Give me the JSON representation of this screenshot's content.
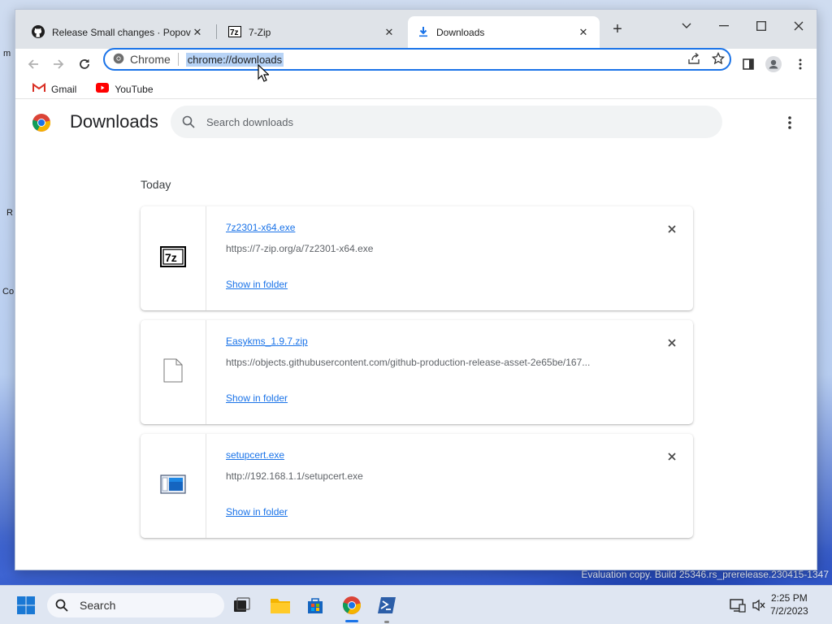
{
  "browser": {
    "tabs": [
      {
        "title": "Release Small changes · PopovEvgeniy",
        "icon": "github-icon",
        "active": false
      },
      {
        "title": "7-Zip",
        "icon": "7zip-icon",
        "active": false
      },
      {
        "title": "Downloads",
        "icon": "download-icon",
        "active": true
      }
    ],
    "omnibox": {
      "chip_label": "Chrome",
      "url": "chrome://downloads"
    },
    "bookmarks": [
      {
        "label": "Gmail",
        "icon": "gmail-icon"
      },
      {
        "label": "YouTube",
        "icon": "youtube-icon"
      }
    ]
  },
  "page": {
    "title": "Downloads",
    "search_placeholder": "Search downloads",
    "section_label": "Today",
    "downloads": [
      {
        "filename": "7z2301-x64.exe",
        "url": "https://7-zip.org/a/7z2301-x64.exe",
        "action": "Show in folder",
        "icon": "7zip-icon"
      },
      {
        "filename": "Easykms_1.9.7.zip",
        "url": "https://objects.githubusercontent.com/github-production-release-asset-2e65be/167...",
        "action": "Show in folder",
        "icon": "file-icon"
      },
      {
        "filename": "setupcert.exe",
        "url": "http://192.168.1.1/setupcert.exe",
        "action": "Show in folder",
        "icon": "installer-icon"
      }
    ]
  },
  "taskbar": {
    "search_label": "Search",
    "time": "2:25 PM",
    "date": "7/2/2023"
  },
  "desktop": {
    "watermark": "Evaluation copy. Build 25346.rs_prerelease.230415-1347"
  },
  "colors": {
    "accent": "#1a73e8",
    "tabstrip": "#dfe3e8",
    "taskbar": "#dfe6f2"
  }
}
